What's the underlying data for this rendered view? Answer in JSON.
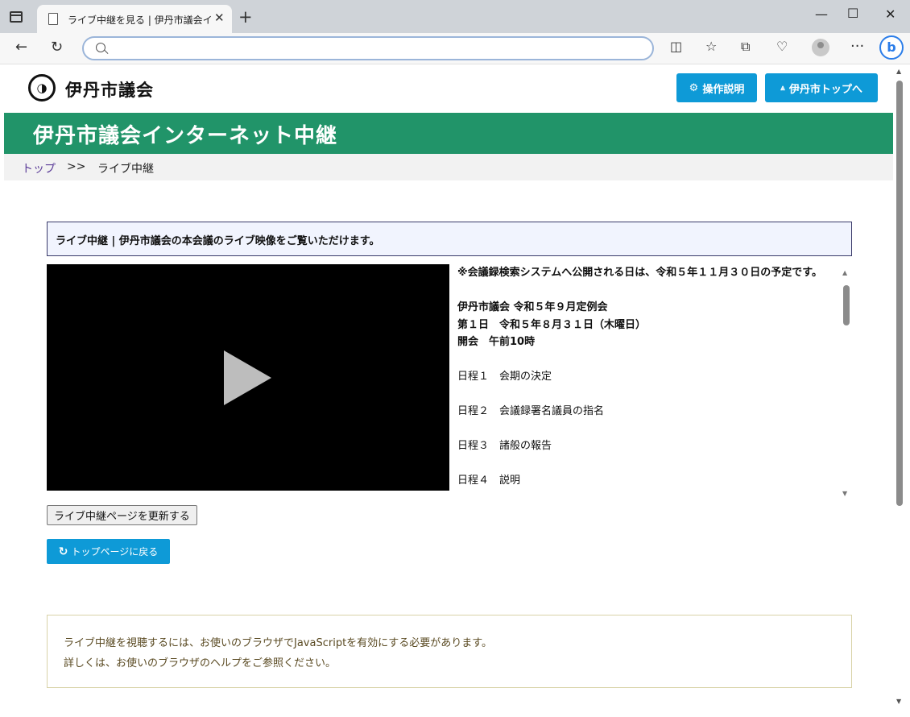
{
  "browser": {
    "tab_title": "ライブ中継を見る | 伊丹市議会インタ",
    "tab_close": "✕",
    "new_tab": "+",
    "minimize": "—",
    "maximize": "☐",
    "close": "✕",
    "back": "←",
    "reload": "↻",
    "address_value": "",
    "address_placeholder": "",
    "more": "···"
  },
  "site": {
    "logo_mark": "◑",
    "logo_text": "伊丹市議会",
    "help_button": "操作説明",
    "top_button": "伊丹市トップへ",
    "banner_title": "伊丹市議会インターネット中継",
    "accent_color": "#0e9ad7",
    "banner_color": "#219469"
  },
  "breadcrumb": {
    "home": "トップ",
    "separator": ">>",
    "current": "ライブ中継"
  },
  "notice": "ライブ中継 | 伊丹市議会の本会議のライブ映像をご覧いただけます。",
  "agenda": {
    "publish_note": "※会議録検索システムへ公開される日は、令和５年１１月３０日の予定です。",
    "session": "伊丹市議会 令和５年９月定例会",
    "day": "第１日　令和５年８月３１日（木曜日）",
    "opening": "開会　午前10時",
    "items": [
      "日程１　会期の決定",
      "日程２　会議録署名議員の指名",
      "日程３　諸般の報告",
      "日程４　説明"
    ]
  },
  "refresh_button": "ライブ中継ページを更新する",
  "back_button": "トップページに戻る",
  "js_note": {
    "line1": "ライブ中継を視聴するには、お使いのブラウザでJavaScriptを有効にする必要があります。",
    "line2": "詳しくは、お使いのブラウザのヘルプをご参照ください。"
  }
}
